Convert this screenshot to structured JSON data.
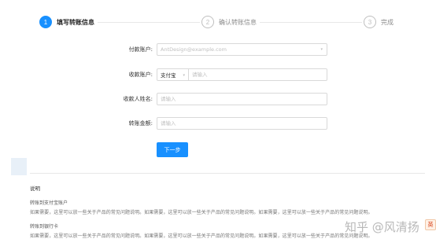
{
  "steps": [
    {
      "number": "1",
      "title": "填写转账信息",
      "status": "active"
    },
    {
      "number": "2",
      "title": "确认转账信息",
      "status": "waiting"
    },
    {
      "number": "3",
      "title": "完成",
      "status": "waiting"
    }
  ],
  "form": {
    "payer_label": "付款账户:",
    "payer_value": "AntDesign@example.com",
    "payee_label": "收款账户:",
    "payee_method": "支付宝",
    "payee_placeholder": "请输入",
    "payee_name_label": "收款人姓名:",
    "payee_name_placeholder": "请输入",
    "amount_label": "转账金额:",
    "amount_placeholder": "请输入",
    "submit_label": "下一步"
  },
  "help": {
    "title": "说明",
    "section1_title": "转账到支付宝账户",
    "section1_text": "如果需要，这里可以放一些关于产品的常见问题说明。如果需要，这里可以放一些关于产品的常见问题说明。如果需要，这里可以放一些关于产品的常见问题说明。",
    "section2_title": "转账到银行卡",
    "section2_text": "如果需要，这里可以放一些关于产品的常见问题说明。如果需要，这里可以放一些关于产品的常见问题说明。如果需要，这里可以放一些关于产品的常见问题说明。"
  },
  "watermark": {
    "text": "知乎 @风清扬",
    "badge": "英"
  },
  "colors": {
    "primary": "#1890ff",
    "border": "#d9d9d9",
    "placeholder": "#bfbfbf"
  },
  "icons": {
    "select_arrow": "chevron-down-icon"
  }
}
